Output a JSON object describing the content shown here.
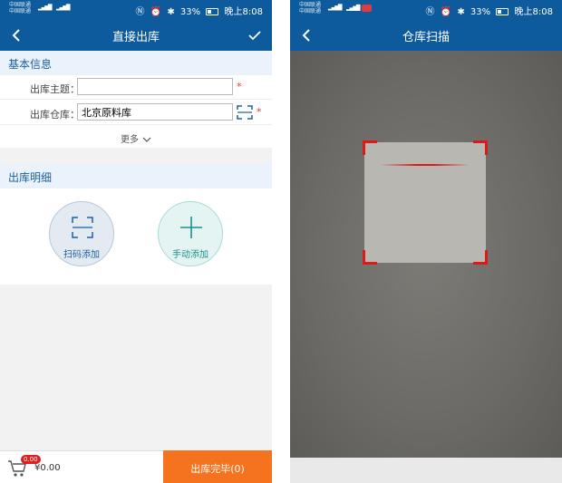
{
  "left": {
    "status": {
      "carrier1": "中国联通",
      "carrier2": "中国联通",
      "battery": "33%",
      "time": "晚上8:08"
    },
    "header": {
      "title": "直接出库"
    },
    "basic_info": {
      "heading": "基本信息",
      "subject_label": "出库主题：",
      "subject_value": "",
      "warehouse_label": "出库仓库：",
      "warehouse_value": "北京原料库",
      "required_mark": "*",
      "more_label": "更多"
    },
    "details": {
      "heading": "出库明细",
      "scan_add_label": "扫码添加",
      "manual_add_label": "手动添加"
    },
    "footer": {
      "cart_count": "0.00",
      "total": "¥0.00",
      "finish_label": "出库完毕(0)"
    }
  },
  "right": {
    "status": {
      "carrier1": "中国联通",
      "carrier2": "中国联通",
      "battery": "33%",
      "time": "晚上8:08"
    },
    "header": {
      "title": "仓库扫描"
    }
  },
  "colors": {
    "header_bg": "#0d5a9c",
    "accent_orange": "#f5731f",
    "scan_red": "#e01818"
  }
}
